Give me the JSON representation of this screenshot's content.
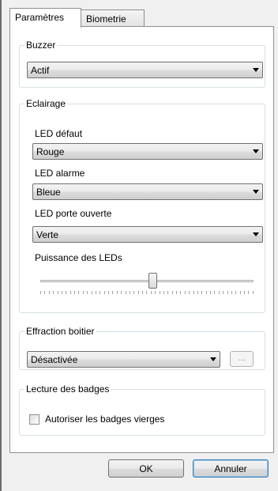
{
  "tabs": [
    {
      "label": "Paramètres",
      "active": true
    },
    {
      "label": "Biometrie",
      "active": false
    }
  ],
  "buzzer": {
    "title": "Buzzer",
    "value": "Actif"
  },
  "lighting": {
    "title": "Eclairage",
    "led_default": {
      "label": "LED défaut",
      "value": "Rouge"
    },
    "led_alarm": {
      "label": "LED alarme",
      "value": "Bleue"
    },
    "led_door_open": {
      "label": "LED porte ouverte",
      "value": "Verte"
    },
    "led_power": {
      "label": "Puissance des LEDs",
      "level_fraction": 0.53,
      "tick_count": 51
    }
  },
  "tamper": {
    "title": "Effraction boitier",
    "value": "Désactivée",
    "browse_label": "..."
  },
  "badges": {
    "title": "Lecture des badges",
    "checkbox_label": "Autoriser les badges vierges",
    "checked": false
  },
  "footer": {
    "ok_label": "OK",
    "cancel_label": "Annuler"
  },
  "colors": {
    "window_bg": "#f0f0f0",
    "panel_bg": "#ffffff",
    "default_button_border": "#3c7fb1"
  }
}
